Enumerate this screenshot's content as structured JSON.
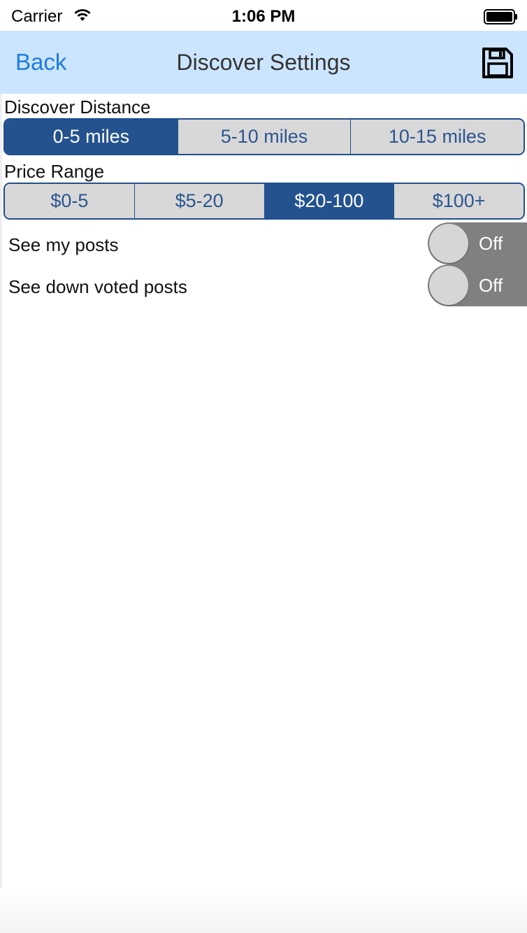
{
  "status_bar": {
    "carrier": "Carrier",
    "time": "1:06 PM",
    "wifi_icon": "wifi-icon",
    "battery_icon": "battery-icon"
  },
  "nav": {
    "back_label": "Back",
    "title": "Discover Settings",
    "save_icon": "save-icon"
  },
  "distance": {
    "label": "Discover Distance",
    "options": [
      "0-5 miles",
      "5-10 miles",
      "10-15 miles"
    ],
    "selected": "0-5 miles"
  },
  "price": {
    "label": "Price Range",
    "options": [
      "$0-5",
      "$5-20",
      "$20-100",
      "$100+"
    ],
    "selected": "$20-100"
  },
  "toggles": [
    {
      "label": "See my posts",
      "state": "Off"
    },
    {
      "label": "See down voted posts",
      "state": "Off"
    }
  ],
  "colors": {
    "nav_background": "#cce5ff",
    "accent_blue": "#23528f",
    "back_link": "#1e7cdf",
    "toggle_off": "#808080"
  }
}
